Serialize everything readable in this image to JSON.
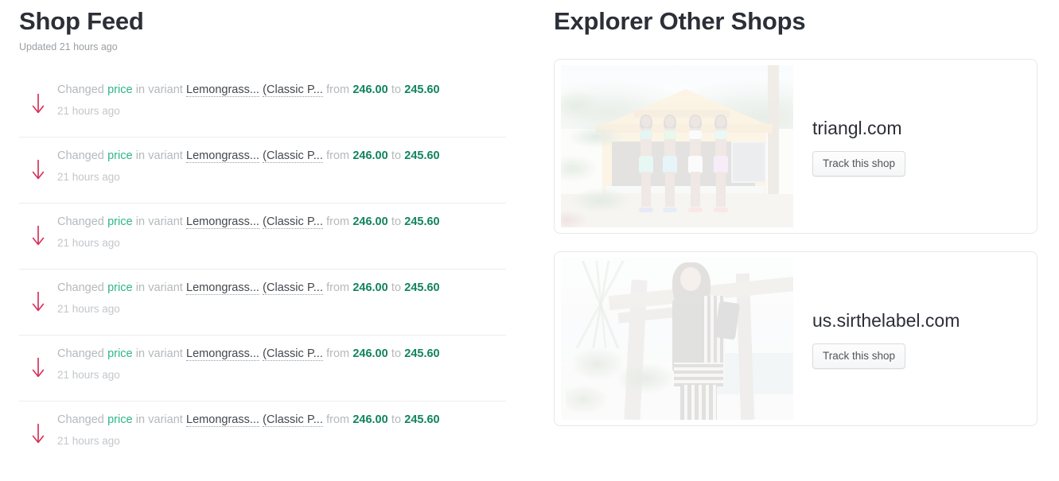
{
  "feed": {
    "title": "Shop Feed",
    "subtitle": "Updated 21 hours ago",
    "items": [
      {
        "icon": "arrow-down-icon",
        "prefix": "Changed",
        "field": "price",
        "mid": "in variant",
        "variant": "Lemongrass...",
        "variant2": "(Classic P...",
        "from_label": "from",
        "from_value": "246.00",
        "to_label": "to",
        "to_value": "245.60",
        "time": "21 hours ago"
      },
      {
        "icon": "arrow-down-icon",
        "prefix": "Changed",
        "field": "price",
        "mid": "in variant",
        "variant": "Lemongrass...",
        "variant2": "(Classic P...",
        "from_label": "from",
        "from_value": "246.00",
        "to_label": "to",
        "to_value": "245.60",
        "time": "21 hours ago"
      },
      {
        "icon": "arrow-down-icon",
        "prefix": "Changed",
        "field": "price",
        "mid": "in variant",
        "variant": "Lemongrass...",
        "variant2": "(Classic P...",
        "from_label": "from",
        "from_value": "246.00",
        "to_label": "to",
        "to_value": "245.60",
        "time": "21 hours ago"
      },
      {
        "icon": "arrow-down-icon",
        "prefix": "Changed",
        "field": "price",
        "mid": "in variant",
        "variant": "Lemongrass...",
        "variant2": "(Classic P...",
        "from_label": "from",
        "from_value": "246.00",
        "to_label": "to",
        "to_value": "245.60",
        "time": "21 hours ago"
      },
      {
        "icon": "arrow-down-icon",
        "prefix": "Changed",
        "field": "price",
        "mid": "in variant",
        "variant": "Lemongrass...",
        "variant2": "(Classic P...",
        "from_label": "from",
        "from_value": "246.00",
        "to_label": "to",
        "to_value": "245.60",
        "time": "21 hours ago"
      },
      {
        "icon": "arrow-down-icon",
        "prefix": "Changed",
        "field": "price",
        "mid": "in variant",
        "variant": "Lemongrass...",
        "variant2": "(Classic P...",
        "from_label": "from",
        "from_value": "246.00",
        "to_label": "to",
        "to_value": "245.60",
        "time": "21 hours ago"
      }
    ]
  },
  "explorer": {
    "title": "Explorer Other Shops",
    "shops": [
      {
        "domain": "triangl.com",
        "track_label": "Track this shop",
        "image": "beach-shack-photo"
      },
      {
        "domain": "us.sirthelabel.com",
        "track_label": "Track this shop",
        "image": "model-by-posts-photo"
      }
    ]
  },
  "colors": {
    "price_down_arrow": "#d6335c",
    "field_green": "#2eb58a",
    "price_green": "#11845f",
    "muted_text": "#b4b9bd",
    "heading": "#2c2f37",
    "divider": "#ececec",
    "card_border": "#e8e8e8"
  }
}
